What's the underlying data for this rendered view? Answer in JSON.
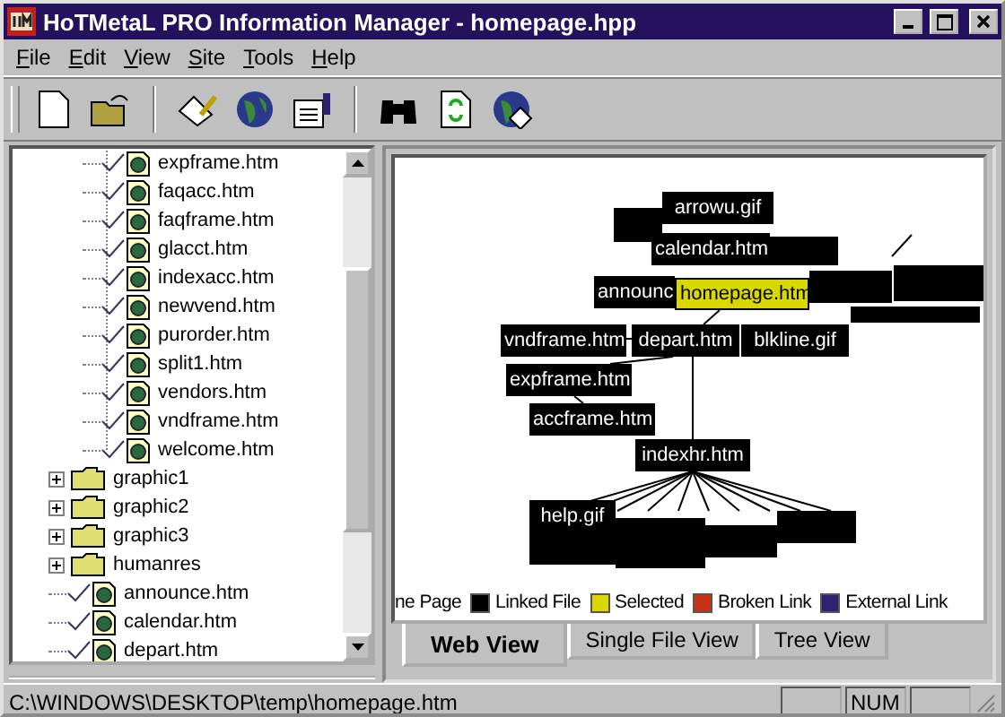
{
  "window": {
    "title": "HoTMetaL PRO  Information Manager - homepage.hpp"
  },
  "menu": [
    "File",
    "Edit",
    "View",
    "Site",
    "Tools",
    "Help"
  ],
  "tree": {
    "items": [
      {
        "kind": "folder",
        "expanded": true,
        "children": [
          {
            "kind": "file",
            "label": "expframe.htm",
            "checked": true
          },
          {
            "kind": "file",
            "label": "faqacc.htm",
            "checked": true
          },
          {
            "kind": "file",
            "label": "faqframe.htm",
            "checked": true
          },
          {
            "kind": "file",
            "label": "glacct.htm",
            "checked": true
          },
          {
            "kind": "file",
            "label": "indexacc.htm",
            "checked": true
          },
          {
            "kind": "file",
            "label": "newvend.htm",
            "checked": true
          },
          {
            "kind": "file",
            "label": "purorder.htm",
            "checked": true
          },
          {
            "kind": "file",
            "label": "split1.htm",
            "checked": true
          },
          {
            "kind": "file",
            "label": "vendors.htm",
            "checked": true
          },
          {
            "kind": "file",
            "label": "vndframe.htm",
            "checked": true
          },
          {
            "kind": "file",
            "label": "welcome.htm",
            "checked": true
          }
        ]
      },
      {
        "kind": "folder",
        "label": "graphic1",
        "expanded": false
      },
      {
        "kind": "folder",
        "label": "graphic2",
        "expanded": false
      },
      {
        "kind": "folder",
        "label": "graphic3",
        "expanded": false
      },
      {
        "kind": "folder",
        "label": "humanres",
        "expanded": false
      },
      {
        "kind": "file",
        "label": "announce.htm",
        "checked": true
      },
      {
        "kind": "file",
        "label": "calendar.htm",
        "checked": true
      },
      {
        "kind": "file",
        "label": "depart.htm",
        "checked": true
      }
    ]
  },
  "web_view": {
    "nodes": [
      {
        "label": "arrowu.gif",
        "selected": false
      },
      {
        "label": "calendar.htm",
        "selected": false
      },
      {
        "label": "announc",
        "selected": false
      },
      {
        "label": "homepage.htm",
        "selected": true
      },
      {
        "label": "vndframe.htm",
        "selected": false
      },
      {
        "label": "depart.htm",
        "selected": false
      },
      {
        "label": "blkline.gif",
        "selected": false
      },
      {
        "label": "expframe.htm",
        "selected": false
      },
      {
        "label": "accframe.htm",
        "selected": false
      },
      {
        "label": "indexhr.htm",
        "selected": false
      },
      {
        "label": "help.gif",
        "selected": false
      }
    ],
    "legend": [
      {
        "label": "ne Page"
      },
      {
        "label": "Linked File",
        "color": "#000000"
      },
      {
        "label": "Selected",
        "color": "#d8d800"
      },
      {
        "label": "Broken Link",
        "color": "#c83214"
      },
      {
        "label": "External Link",
        "color": "#2c2470"
      }
    ]
  },
  "tabs": [
    {
      "label": "Web View",
      "selected": true
    },
    {
      "label": "Single File View",
      "selected": false
    },
    {
      "label": "Tree View",
      "selected": false
    }
  ],
  "status_bar": {
    "path": "C:\\WINDOWS\\DESKTOP\\temp\\homepage.htm",
    "num_indicator": "NUM"
  }
}
